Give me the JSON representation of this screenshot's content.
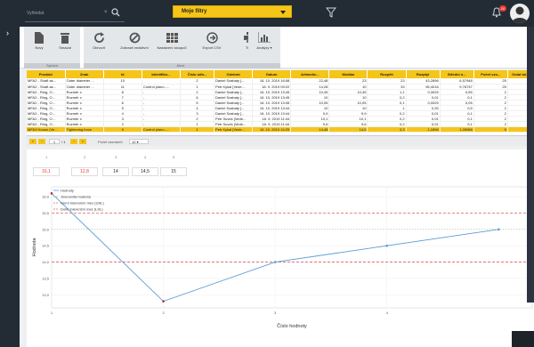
{
  "topbar": {
    "search_label": "Vyhledat",
    "search_clear": "×",
    "filter_title": "Moje filtry",
    "notification_count": "10"
  },
  "toolbar": {
    "buttons": [
      {
        "label": "Nový",
        "icon": "new-file-icon"
      },
      {
        "label": "Smazat",
        "icon": "trash-icon"
      },
      {
        "label": "Obnovit",
        "icon": "refresh-icon"
      },
      {
        "label": "Zobrazit neaktivní",
        "icon": "ban-icon"
      },
      {
        "label": "Nastavení sloupců",
        "icon": "table-icon"
      },
      {
        "label": "Export CSV",
        "icon": "arrow-right-circle-icon"
      },
      {
        "label": "Tisk",
        "icon": "print-icon"
      },
      {
        "label": "Analýzy",
        "icon": "bar-chart-icon"
      }
    ],
    "groups": [
      "Správa",
      "Akce"
    ]
  },
  "table": {
    "columns": [
      "Produkt",
      "Znak",
      "Id",
      "Identifiko...",
      "Číslo odb...",
      "Odebral",
      "Datum",
      "Aritmetic...",
      "Medián",
      "Rozpětí",
      "Rozptyl",
      "Střední o...",
      "Počet vzo...",
      "Ostat tol..."
    ],
    "rows": [
      [
        "MFA2 - Shaft as...",
        "Outer diameter ...",
        "10",
        "",
        "2",
        "Daniel Szabaty [...",
        "16. 10. 2019 16:58",
        "22,48",
        "23",
        "23",
        "43,2896",
        "6,57948",
        "25",
        "2"
      ],
      [
        "MFA2 - Shaft as...",
        "Outer diameter ...",
        "11",
        "Control plano -...",
        "1",
        "Petr Kykal [Vede...",
        "18. 9. 2019 09:22",
        "14,28",
        "10",
        "33",
        "95,4016",
        "9,76737",
        "25",
        "2"
      ],
      [
        "MFA2 - Ring, O...",
        "Rozměr x",
        "8",
        "-",
        "2",
        "Daniel Szabaty [...",
        "16. 10. 2019 13:45",
        "10,45",
        "10,45",
        "1,1",
        "0,3025",
        "0,55",
        "2",
        "2"
      ],
      [
        "MFA2 - Ring, O...",
        "Rozměr x",
        "7",
        "-",
        "6",
        "Daniel Szabaty [...",
        "16. 10. 2019 13:45",
        "10",
        "10",
        "0,2",
        "0,01",
        "0,1",
        "2",
        "2"
      ],
      [
        "MFA2 - Ring, O...",
        "Rozměr x",
        "6",
        "-",
        "5",
        "Daniel Szabaty [...",
        "16. 10. 2019 13:45",
        "10,05",
        "10,05",
        "0,1",
        "0,0025",
        "0,05",
        "2",
        "2"
      ],
      [
        "MFA2 - Ring, O...",
        "Rozměr x",
        "5",
        "-",
        "4",
        "Daniel Szabaty [...",
        "16. 10. 2019 13:44",
        "10",
        "10",
        "1",
        "0,25",
        "0,5",
        "2",
        "2"
      ],
      [
        "MFA2 - Ring, O...",
        "Rozměr x",
        "4",
        "-",
        "3",
        "Daniel Szabaty [...",
        "16. 10. 2019 13:44",
        "9,9",
        "9,9",
        "0,2",
        "0,01",
        "0,1",
        "2",
        "2"
      ],
      [
        "MFA2 - Ring, O...",
        "Rozměr x",
        "3",
        "-",
        "2",
        "Petr Suvek [Vede...",
        "18. 9. 2019 11:44",
        "10,1",
        "10,1",
        "0,2",
        "0,01",
        "0,1",
        "2",
        "2"
      ],
      [
        "MFA2 - Ring, O...",
        "Rozměr x",
        "2",
        "-",
        "1",
        "Petr Suvek [Vede...",
        "18. 9. 2019 11:44",
        "9,6",
        "9,6",
        "0,2",
        "0,01",
        "0,1",
        "2",
        "2"
      ],
      [
        "MFA3 House (Ve...",
        "Tightening force",
        "9",
        "Control plano -...",
        "1",
        "Petr Kykal [Vede...",
        "16. 10. 2019 14:25",
        "14,48",
        "14,5",
        "3,3",
        "1,1896",
        "1,09068",
        "5",
        "2"
      ]
    ],
    "selected_index": 9
  },
  "pager": {
    "first": "«",
    "prev": "‹",
    "page": "1",
    "of": "/ 1",
    "next": "›",
    "last": "»",
    "size_label": "Počet záznamů",
    "size_value": "10"
  },
  "chart": {
    "top_index_labels": [
      "1",
      "2",
      "3",
      "4",
      "5"
    ],
    "top_values": [
      "16,1",
      "12,8",
      "14",
      "14,5",
      "15"
    ],
    "legend": [
      "Hodnoty",
      "Jmenovitá hodnota",
      "Horní tolerenční mez (USL)",
      "Dolní tolerenční mez (LSL)"
    ],
    "colors": {
      "values": "#5b9bd5",
      "nominal": "#8fbc8f",
      "usl": "#e06060",
      "lsl": "#e06060"
    }
  },
  "chart_data": {
    "type": "line",
    "title": "",
    "xlabel": "Číslo hodnoty",
    "ylabel": "Hodnota",
    "x": [
      1,
      2,
      3,
      4,
      5
    ],
    "series": [
      {
        "name": "Hodnoty",
        "values": [
          16.1,
          12.8,
          14,
          14.5,
          15
        ]
      }
    ],
    "nominal": 15,
    "usl": 15.5,
    "lsl": 14,
    "ylim": [
      12.6,
      16.3
    ],
    "y_ticks": [
      "13,0",
      "13,5",
      "14,0",
      "14,5",
      "15,0",
      "15,5",
      "16,0"
    ],
    "x_ticks": [
      "1",
      "2",
      "3",
      "4"
    ]
  }
}
